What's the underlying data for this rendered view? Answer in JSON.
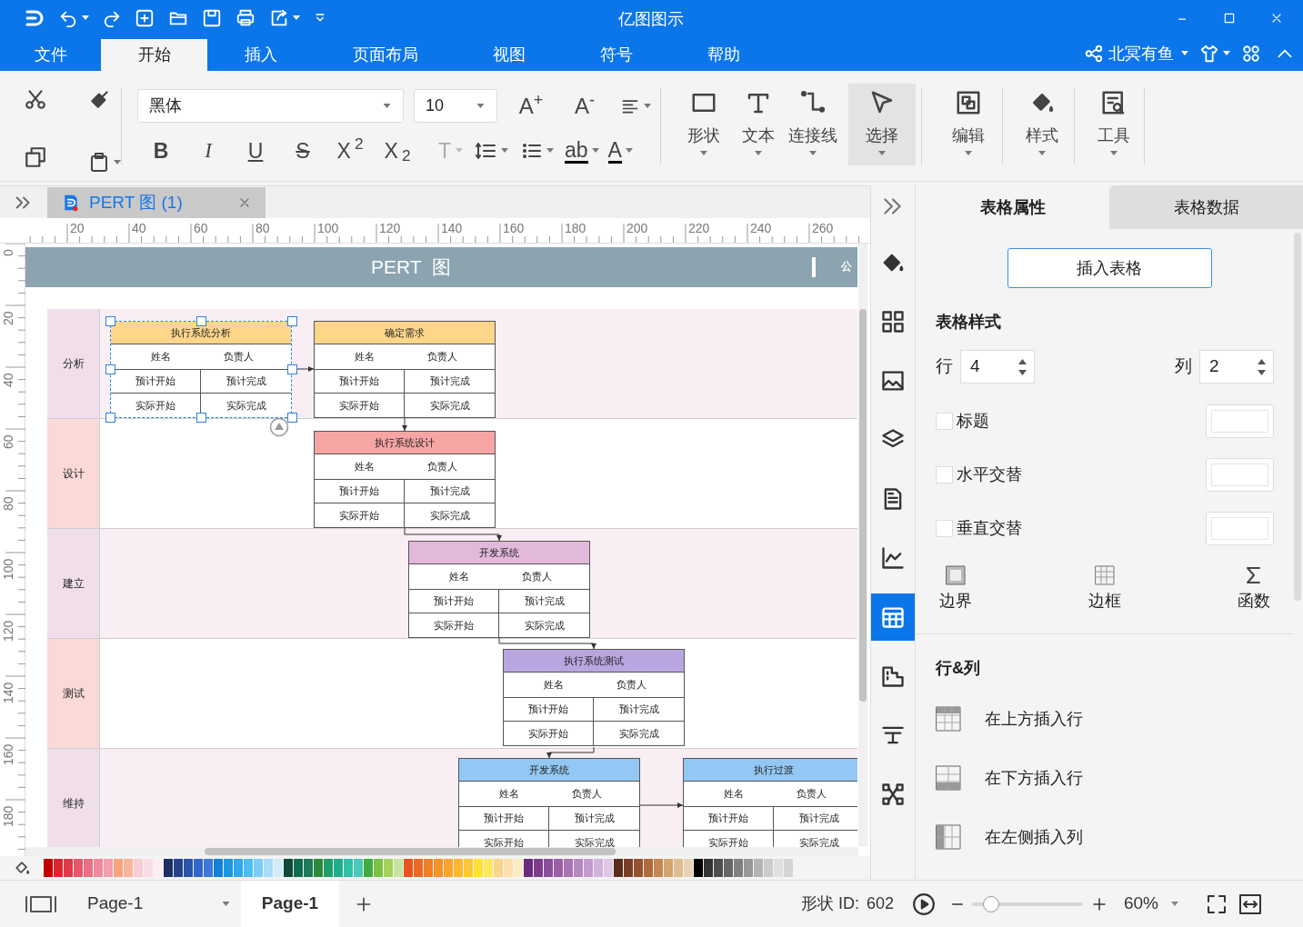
{
  "title_bar": {
    "title": "亿图图示"
  },
  "menu_tabs": [
    {
      "label": "文件",
      "selected": false
    },
    {
      "label": "开始",
      "selected": true
    },
    {
      "label": "插入",
      "selected": false
    },
    {
      "label": "页面布局",
      "selected": false
    },
    {
      "label": "视图",
      "selected": false
    },
    {
      "label": "符号",
      "selected": false
    },
    {
      "label": "帮助",
      "selected": false
    }
  ],
  "account": {
    "user": "北冥有鱼"
  },
  "ribbon": {
    "font": "黑体",
    "font_size": "10",
    "size_buttons": [
      "A$^{+}$",
      "A$^{-}$"
    ],
    "format_buttons": [
      {
        "label": "B",
        "disabled": false
      },
      {
        "label": "I",
        "disabled": false
      },
      {
        "label": "U",
        "disabled": false
      },
      {
        "label": "S",
        "disabled": false
      },
      {
        "label": "X$^{2}$",
        "disabled": false
      },
      {
        "label": "X$_{2}$",
        "disabled": false
      },
      {
        "label": "T",
        "disabled": true
      }
    ],
    "color_buttons": [
      "ab",
      "A"
    ],
    "tools": [
      {
        "label": "形状",
        "selected": false
      },
      {
        "label": "文本",
        "selected": false
      },
      {
        "label": "连接线",
        "selected": false
      },
      {
        "label": "选择",
        "selected": true
      },
      {
        "label": "编辑",
        "selected": false
      },
      {
        "label": "样式",
        "selected": false
      },
      {
        "label": "工具",
        "selected": false
      }
    ]
  },
  "document_tab": {
    "title": "PERT 图 (1)"
  },
  "ruler": {
    "horizontal": [
      "20",
      "40",
      "60",
      "80",
      "100",
      "120",
      "140",
      "160",
      "180",
      "200",
      "220",
      "240",
      "260"
    ],
    "vertical": [
      "0",
      "20",
      "40",
      "60",
      "80",
      "100",
      "120",
      "140",
      "160",
      "180"
    ]
  },
  "diagram": {
    "title": "PERT  图",
    "title_side": "公",
    "lanes": [
      {
        "label": "分析",
        "color": "#f0dfea"
      },
      {
        "label": "设计",
        "color": "#fbd9d9"
      },
      {
        "label": "建立",
        "color": "#f0dfea"
      },
      {
        "label": "测试",
        "color": "#fbd9d9"
      },
      {
        "label": "维持",
        "color": "#f0dfea"
      }
    ],
    "nodes": [
      {
        "title": "执行系统分析",
        "color": "#fdd68a",
        "selected": true,
        "cells": [
          "姓名",
          "负责人",
          "预计开始",
          "预计完成",
          "实际开始",
          "实际完成"
        ]
      },
      {
        "title": "确定需求",
        "color": "#fdd68a",
        "selected": false,
        "cells": [
          "姓名",
          "负责人",
          "预计开始",
          "预计完成",
          "实际开始",
          "实际完成"
        ]
      },
      {
        "title": "执行系统设计",
        "color": "#f7a4a4",
        "selected": false,
        "cells": [
          "姓名",
          "负责人",
          "预计开始",
          "预计完成",
          "实际开始",
          "实际完成"
        ]
      },
      {
        "title": "开发系统",
        "color": "#e3b9da",
        "selected": false,
        "cells": [
          "姓名",
          "负责人",
          "预计开始",
          "预计完成",
          "实际开始",
          "实际完成"
        ]
      },
      {
        "title": "执行系统测试",
        "color": "#b9a6e1",
        "selected": false,
        "cells": [
          "姓名",
          "负责人",
          "预计开始",
          "预计完成",
          "实际开始",
          "实际完成"
        ]
      },
      {
        "title": "开发系统",
        "color": "#92c8f3",
        "selected": false,
        "cells": [
          "姓名",
          "负责人",
          "预计开始",
          "预计完成",
          "实际开始",
          "实际完成"
        ]
      },
      {
        "title": "执行过渡",
        "color": "#92c8f3",
        "selected": false,
        "cells": [
          "姓名",
          "负责人",
          "预计开始",
          "预计完成",
          "实际开始",
          "实际完成"
        ]
      }
    ]
  },
  "palette": [
    {
      "color": "#c00000"
    },
    {
      "color": "#d9262f"
    },
    {
      "color": "#e23a4c"
    },
    {
      "color": "#e8566b"
    },
    {
      "color": "#ec6f85"
    },
    {
      "color": "#ee8a9c"
    },
    {
      "color": "#f29fae"
    },
    {
      "color": "#f6a37f"
    },
    {
      "color": "#f5b69a"
    },
    {
      "color": "#f8cdd6"
    },
    {
      "color": "#fbdde6"
    },
    {
      "color": "#fdeef2"
    },
    {
      "color": "#1f2f63"
    },
    {
      "color": "#24418a"
    },
    {
      "color": "#2a55a8"
    },
    {
      "color": "#3366cc"
    },
    {
      "color": "#3c78d8"
    },
    {
      "color": "#1681d6"
    },
    {
      "color": "#1b98e0"
    },
    {
      "color": "#2eaaea"
    },
    {
      "color": "#4fbdf2"
    },
    {
      "color": "#7ccdf4"
    },
    {
      "color": "#a9dcf6"
    },
    {
      "color": "#d2ecfa"
    },
    {
      "color": "#0d4a3a"
    },
    {
      "color": "#106b4f"
    },
    {
      "color": "#1c7c5c"
    },
    {
      "color": "#2d8a3d"
    },
    {
      "color": "#1f9d6a"
    },
    {
      "color": "#20ad8a"
    },
    {
      "color": "#2ec1a6"
    },
    {
      "color": "#4cc8b8"
    },
    {
      "color": "#3fae3f"
    },
    {
      "color": "#7cc242"
    },
    {
      "color": "#a4d35a"
    },
    {
      "color": "#c8e3a1"
    },
    {
      "color": "#e8531e"
    },
    {
      "color": "#ee6a22"
    },
    {
      "color": "#f27f26"
    },
    {
      "color": "#f6922a"
    },
    {
      "color": "#f8a52d"
    },
    {
      "color": "#fbb731"
    },
    {
      "color": "#fcc934"
    },
    {
      "color": "#fee034"
    },
    {
      "color": "#fde85c"
    },
    {
      "color": "#f8d58a"
    },
    {
      "color": "#fbe0a9"
    },
    {
      "color": "#fdebc8"
    },
    {
      "color": "#6b2c7d"
    },
    {
      "color": "#7d3c8c"
    },
    {
      "color": "#8c4d9b"
    },
    {
      "color": "#9b5fa8"
    },
    {
      "color": "#a873b5"
    },
    {
      "color": "#b688c2"
    },
    {
      "color": "#c39cce"
    },
    {
      "color": "#d1b2da"
    },
    {
      "color": "#dfc8e6"
    },
    {
      "color": "#5c2d1e"
    },
    {
      "color": "#7a3e25"
    },
    {
      "color": "#96522f"
    },
    {
      "color": "#b06a3b"
    },
    {
      "color": "#c4884f"
    },
    {
      "color": "#d3a46d"
    },
    {
      "color": "#dfbd92"
    },
    {
      "color": "#ead4b7"
    },
    {
      "color": "#000000"
    },
    {
      "color": "#333333"
    },
    {
      "color": "#4d4d4d"
    },
    {
      "color": "#666666"
    },
    {
      "color": "#808080"
    },
    {
      "color": "#999999"
    },
    {
      "color": "#b3b3b3"
    },
    {
      "color": "#cccccc"
    },
    {
      "color": "#e0e0e0"
    },
    {
      "color": "#d4d4d4"
    }
  ],
  "side_icons": [
    {
      "selected": false
    },
    {
      "selected": false
    },
    {
      "selected": false
    },
    {
      "selected": false
    },
    {
      "selected": false
    },
    {
      "selected": false
    },
    {
      "selected": true
    },
    {
      "selected": false
    },
    {
      "selected": false
    },
    {
      "selected": false
    }
  ],
  "properties": {
    "tabs": [
      {
        "label": "表格属性",
        "selected": true
      },
      {
        "label": "表格数据",
        "selected": false
      }
    ],
    "insert_button": "插入表格",
    "style_heading": "表格样式",
    "rows": {
      "label": "行",
      "value": "4"
    },
    "columns": {
      "label": "列",
      "value": "2"
    },
    "options": [
      {
        "label": "标题",
        "checked": false
      },
      {
        "label": "水平交替",
        "checked": false
      },
      {
        "label": "垂直交替",
        "checked": false
      }
    ],
    "tools": [
      "边界",
      "边框",
      "函数"
    ],
    "rows_heading": "行&列",
    "row_actions": [
      "在上方插入行",
      "在下方插入行",
      "在左侧插入列"
    ]
  },
  "status_bar": {
    "page_select": "Page-1",
    "page_tab": "Page-1",
    "shape_id_label": "形状 ID:",
    "shape_id": "602",
    "zoom": {
      "level": 0.17
    },
    "zoom_value": "60%"
  }
}
